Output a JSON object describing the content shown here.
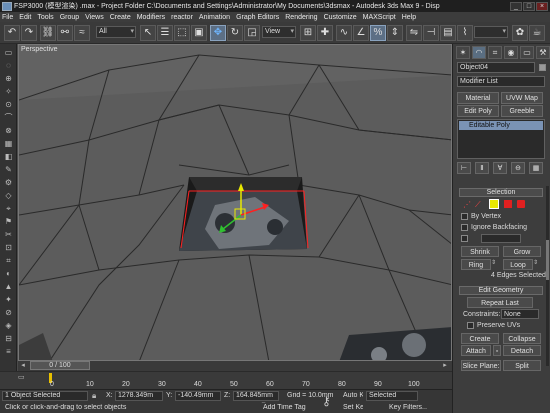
{
  "title_bar": {
    "title": "FSP3000 (模型渲染) .max   - Project Folder  C:\\Documents and Settings\\Administrator\\My Documents\\3dsmax   - Autodesk 3ds Max 9   - Disp",
    "minimize": "_",
    "maximize": "□",
    "close": "×"
  },
  "menu": [
    "File",
    "Edit",
    "Tools",
    "Group",
    "Views",
    "Create",
    "Modifiers",
    "reactor",
    "Animation",
    "Graph Editors",
    "Rendering",
    "Customize",
    "MAXScript",
    "Help"
  ],
  "toolbar": {
    "selection_filter": "All",
    "reference_coord": "View"
  },
  "viewport": {
    "label": "Perspective"
  },
  "panel": {
    "object_name": "Object04",
    "modifier_list": "Modifier List",
    "buttons": {
      "material": "Material",
      "uvw_map": "UVW Map",
      "edit_poly": "Edit Poly",
      "greeble": "Greeble"
    },
    "stack_item": "Editable Poly",
    "selection": {
      "header": "Selection",
      "by_vertex": "By Vertex",
      "ignore_backfacing": "Ignore Backfacing",
      "shrink": "Shrink",
      "grow": "Grow",
      "ring": "Ring",
      "loop": "Loop",
      "status": "4 Edges Selected"
    },
    "edit_geometry": {
      "header": "Edit Geometry",
      "repeat_last": "Repeat Last",
      "constraints_label": "Constraints:",
      "constraints_value": "None",
      "preserve_uvs": "Preserve UVs",
      "create": "Create",
      "collapse": "Collapse",
      "attach": "Attach",
      "detach": "Detach",
      "slice_plane_label": "Slice Plane:",
      "split": "Split"
    }
  },
  "timeline": {
    "frame": "0 / 100",
    "ticks": [
      "0",
      "10",
      "20",
      "30",
      "40",
      "50",
      "60",
      "70",
      "80",
      "90",
      "100"
    ]
  },
  "status": {
    "objects": "1 Object Selected",
    "prompt": "Click or click-and-drag to select objects",
    "x_label": "X:",
    "x": "1278.349m",
    "y_label": "Y:",
    "y": "-140.49mm",
    "z_label": "Z:",
    "z": "164.845mm",
    "grid": "Grid = 10.0mm",
    "add_time_tag": "Add Time Tag",
    "auto_key": "Auto Key",
    "auto_key_mode": "Selected",
    "set_key": "Set Key",
    "key_filters": "Key Filters..."
  }
}
